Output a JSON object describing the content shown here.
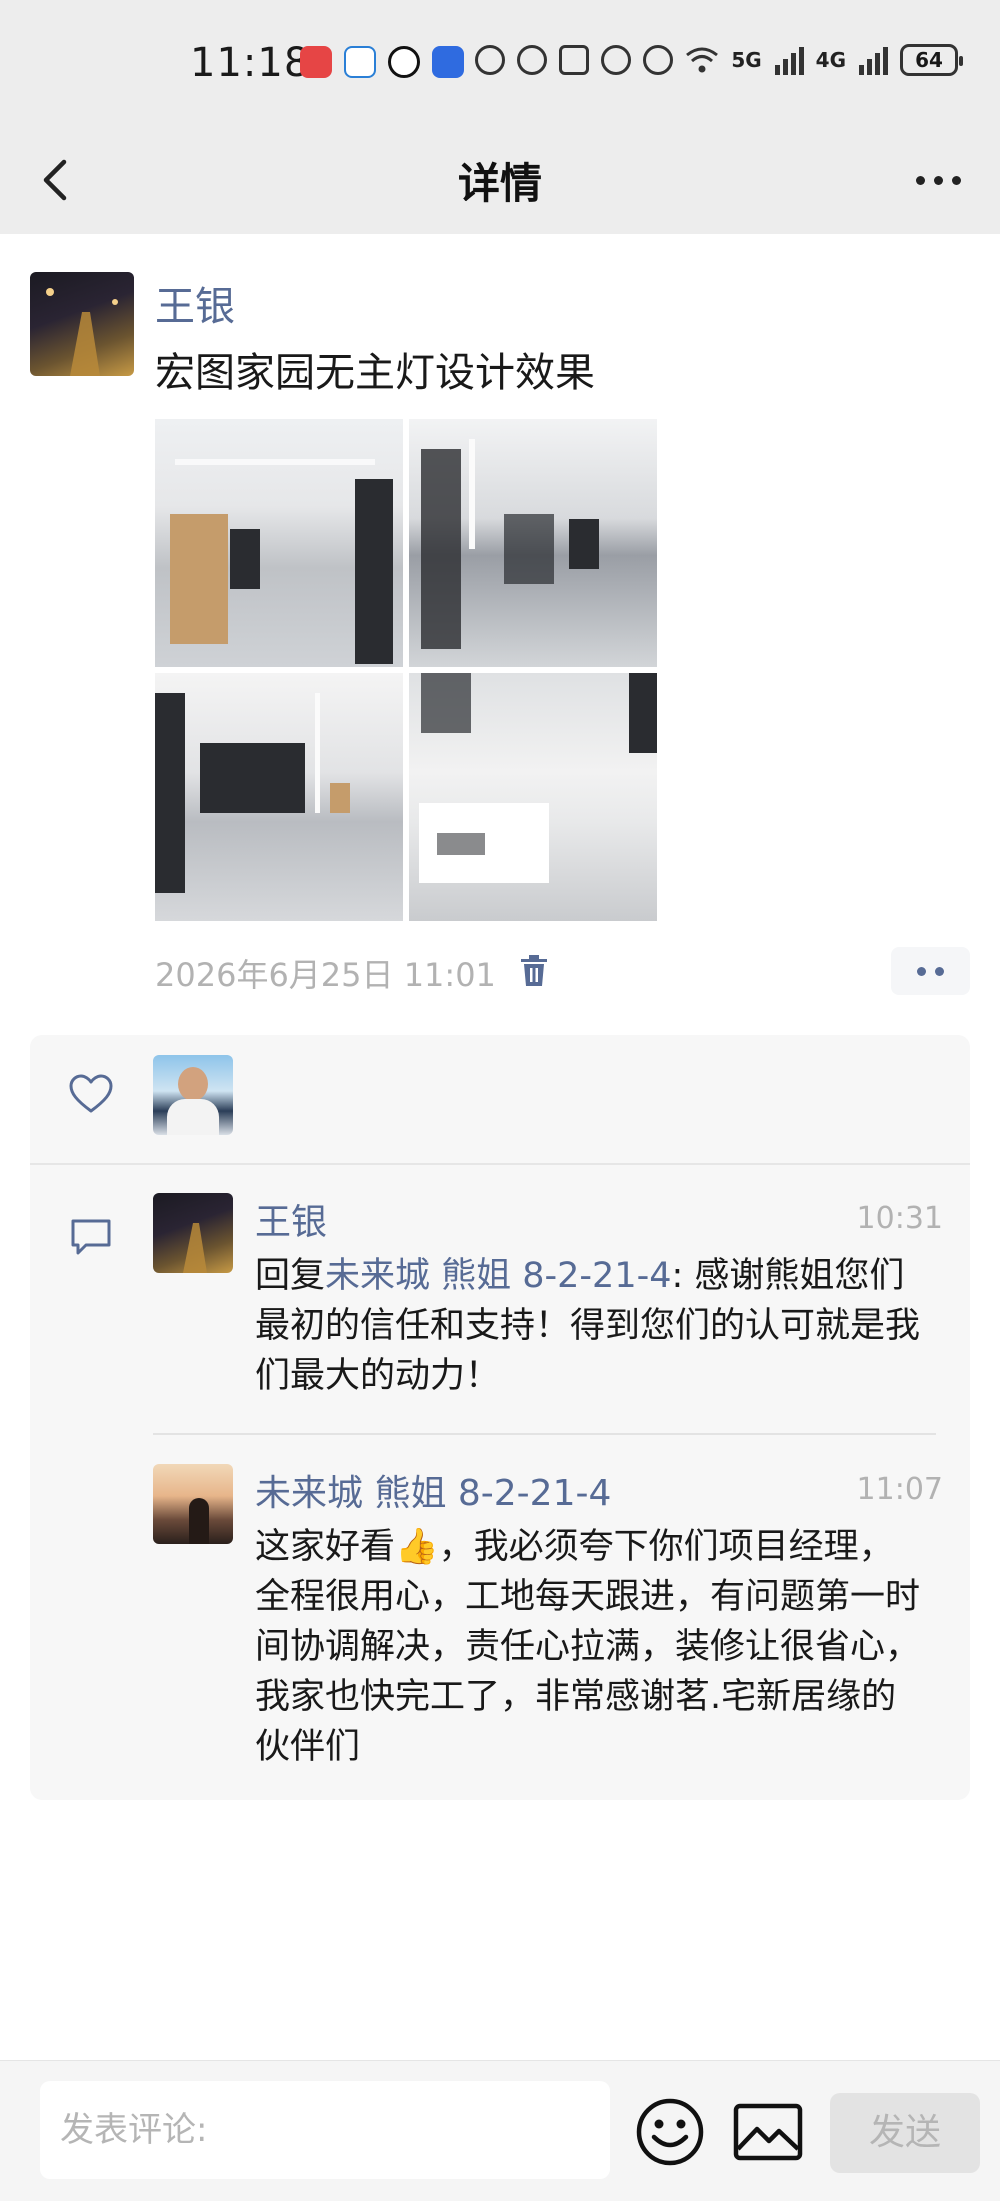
{
  "status_bar": {
    "time": "11:18",
    "signal_5g": "5G",
    "signal_4g": "4G",
    "battery": "64"
  },
  "nav": {
    "title": "详情"
  },
  "post": {
    "author": "王银",
    "text": "宏图家园无主灯设计效果",
    "photos": [
      "photo-1",
      "photo-2",
      "photo-3",
      "photo-4"
    ],
    "timestamp": "2026年6月25日 11:01"
  },
  "comments": [
    {
      "author": "王银",
      "time": "10:31",
      "reply_prefix": "回复",
      "reply_to": "未来城 熊姐 8-2-21-4",
      "text": ": 感谢熊姐您们最初的信任和支持！得到您们的认可就是我们最大的动力！"
    },
    {
      "author": "未来城 熊姐 8-2-21-4",
      "time": "11:07",
      "text_before_emoji": "这家好看",
      "emoji": "👍",
      "text_after_emoji": "，我必须夸下你们项目经理，全程很用心，工地每天跟进，有问题第一时间协调解决，责任心拉满，装修让很省心，我家也快完工了，非常感谢茗.宅新居缘的伙伴们"
    }
  ],
  "bottom_bar": {
    "placeholder": "发表评论:",
    "send_label": "发送"
  },
  "colors": {
    "link": "#576b95",
    "background_bar": "#ededed",
    "panel": "#f7f7f7"
  }
}
